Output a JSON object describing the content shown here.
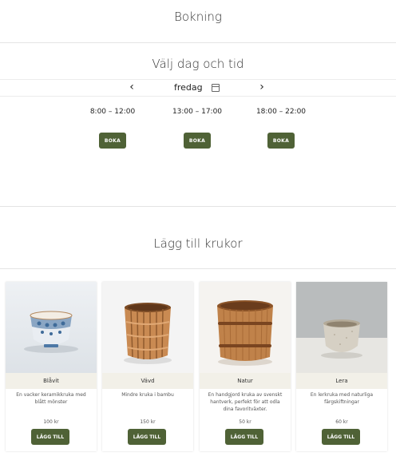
{
  "header": {
    "title": "Bokning"
  },
  "booking": {
    "title": "Välj dag och tid",
    "day": "fredag",
    "prev_icon": "chevron-left-icon",
    "next_icon": "chevron-right-icon",
    "calendar_icon": "calendar-icon",
    "slots": [
      {
        "time": "8:00 – 12:00",
        "button": "BOKA"
      },
      {
        "time": "13:00 – 17:00",
        "button": "BOKA"
      },
      {
        "time": "18:00 – 22:00",
        "button": "BOKA"
      }
    ]
  },
  "pots": {
    "title": "Lägg till krukor",
    "items": [
      {
        "name": "Blåvit",
        "description": "En vacker keramikkruka med blått mönster",
        "price": "100 kr",
        "button": "LÄGG TILL"
      },
      {
        "name": "Vävd",
        "description": "Mindre kruka i bambu",
        "price": "150 kr",
        "button": "LÄGG TILL"
      },
      {
        "name": "Natur",
        "description": "En handgjord kruka av svenskt hantverk, perfekt för att odla dina favoritväxter.",
        "price": "50 kr",
        "button": "LÄGG TILL"
      },
      {
        "name": "Lera",
        "description": "En lerkruka med naturliga färgskiftningar",
        "price": "60 kr",
        "button": "LÄGG TILL"
      }
    ]
  },
  "colors": {
    "accent": "#4f6236",
    "card_label_bg": "#f2f0e8"
  }
}
